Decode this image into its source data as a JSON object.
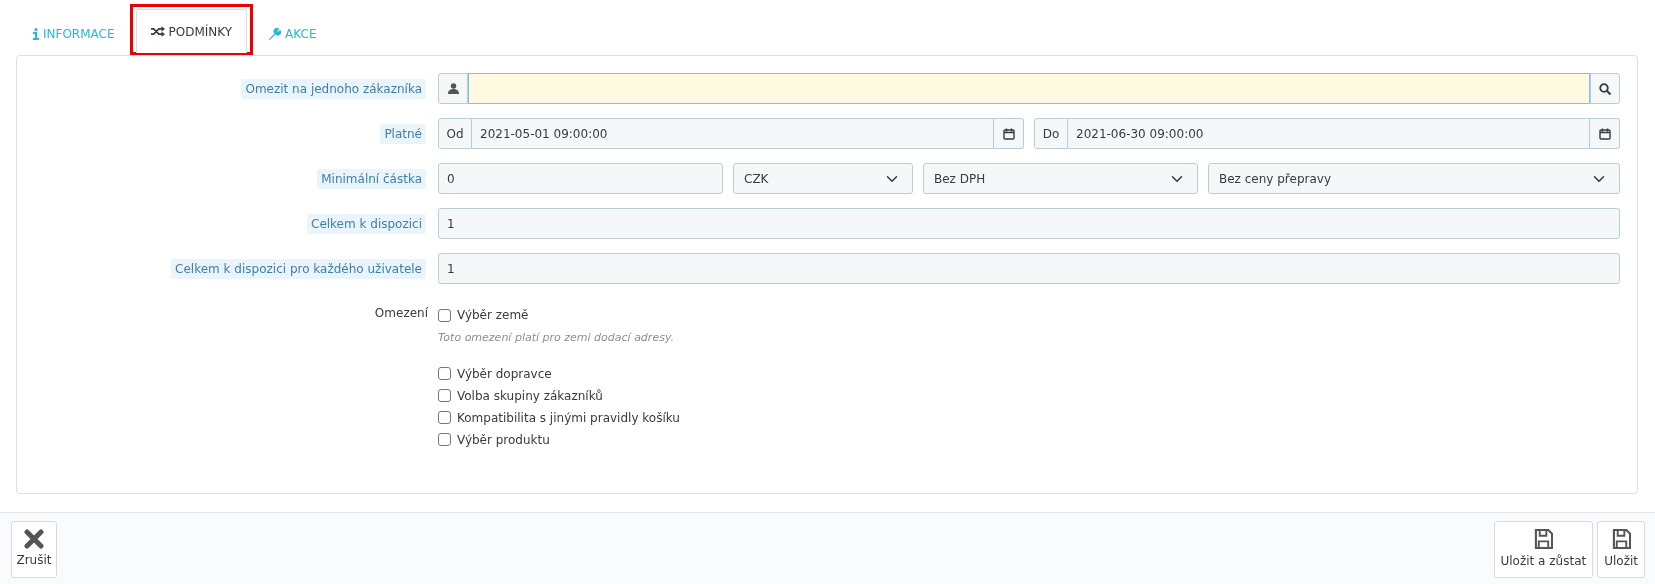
{
  "tabs": [
    {
      "label": "INFORMACE",
      "selected": false,
      "highlighted": false
    },
    {
      "label": "PODMÍNKY",
      "selected": true,
      "highlighted": true
    },
    {
      "label": "AKCE",
      "selected": false,
      "highlighted": false
    }
  ],
  "customer": {
    "label": "Omezit na jednoho zákazníka",
    "focused": true
  },
  "validity": {
    "label": "Platné",
    "from_prefix": "Od",
    "from": "2021-05-01 09:00:00",
    "to_prefix": "Do",
    "to": "2021-06-30 09:00:00"
  },
  "minimum_amount": {
    "label": "Minimální částka",
    "amount": "0",
    "currency": "CZK",
    "tax": "Bez DPH",
    "shipping": "Bez ceny přepravy"
  },
  "total_available": {
    "label": "Celkem k dispozici",
    "value": "1"
  },
  "total_per_user": {
    "label": "Celkem k dispozici pro každého uživatele",
    "value": "1"
  },
  "restrictions": {
    "label": "Omezení",
    "items": [
      {
        "label": "Výběr země",
        "checked": false,
        "help": "Toto omezení platí pro zemi dodací adresy."
      },
      {
        "label": "Výběr dopravce",
        "checked": false
      },
      {
        "label": "Volba skupiny zákazníků",
        "checked": false
      },
      {
        "label": "Kompatibilita s jinými pravidly košíku",
        "checked": false
      },
      {
        "label": "Výběr produktu",
        "checked": false
      }
    ]
  },
  "footer": {
    "cancel": "Zrušit",
    "save_stay": "Uložit a zůstat",
    "save": "Uložit"
  }
}
